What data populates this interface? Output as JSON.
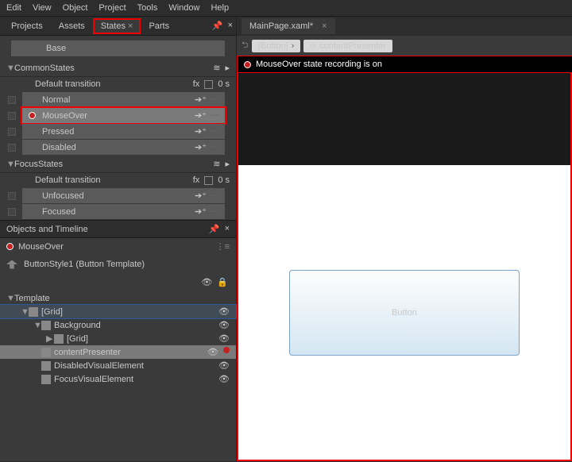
{
  "menu": [
    "Edit",
    "View",
    "Object",
    "Project",
    "Tools",
    "Window",
    "Help"
  ],
  "leftTabs": {
    "items": [
      "Projects",
      "Assets",
      "States",
      "Parts"
    ],
    "active": "States",
    "highlight": "States"
  },
  "states": {
    "base": "Base",
    "groups": [
      {
        "name": "CommonStates",
        "transition": {
          "label": "Default transition",
          "time": "0 s"
        },
        "states": [
          {
            "name": "Normal"
          },
          {
            "name": "MouseOver",
            "active": true,
            "highlight": true
          },
          {
            "name": "Pressed"
          },
          {
            "name": "Disabled"
          }
        ]
      },
      {
        "name": "FocusStates",
        "transition": {
          "label": "Default transition",
          "time": "0 s"
        },
        "states": [
          {
            "name": "Unfocused"
          },
          {
            "name": "Focused"
          }
        ]
      }
    ]
  },
  "timeline": {
    "title": "Objects and Timeline",
    "recording": "MouseOver",
    "template": "ButtonStyle1 (Button Template)",
    "root": "Template",
    "tree": [
      {
        "depth": 0,
        "label": "[Grid]",
        "sel": true,
        "twisty": "▼"
      },
      {
        "depth": 1,
        "label": "Background",
        "twisty": "▼"
      },
      {
        "depth": 2,
        "label": "[Grid]",
        "twisty": "▶"
      },
      {
        "depth": 1,
        "label": "contentPresenter",
        "sel2": true
      },
      {
        "depth": 1,
        "label": "DisabledVisualElement"
      },
      {
        "depth": 1,
        "label": "FocusVisualElement"
      }
    ]
  },
  "doc": {
    "tab": "MainPage.xaml*",
    "crumbs": [
      "[Button]",
      "contentPresenter"
    ],
    "recmsg": "MouseOver state recording is on",
    "button": "Button"
  }
}
